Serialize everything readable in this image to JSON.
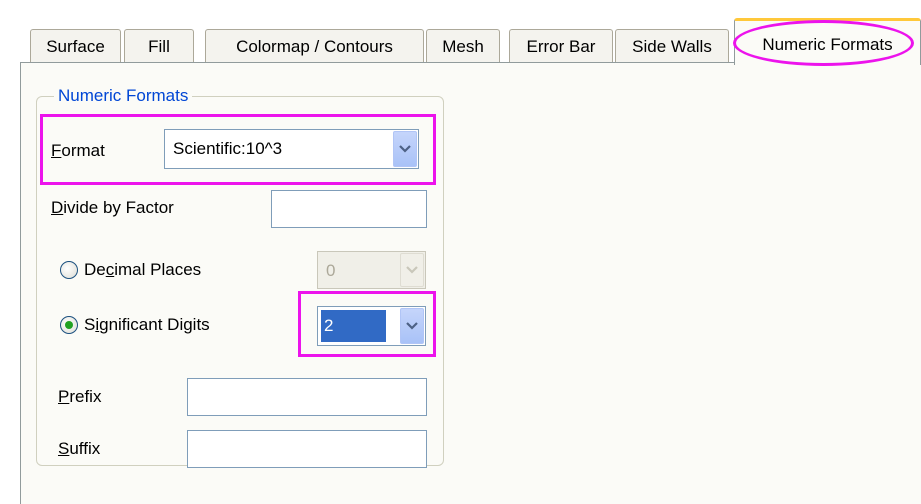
{
  "tabs": [
    {
      "label": "Surface",
      "accel": ""
    },
    {
      "label": "Fill",
      "accel": ""
    },
    {
      "label": "Colormap / Contours",
      "accel": ""
    },
    {
      "label": "Mesh",
      "accel": ""
    },
    {
      "label": "Error Bar",
      "accel": ""
    },
    {
      "label": "Side Walls",
      "accel": ""
    },
    {
      "label": "Numeric Formats",
      "accel": ""
    }
  ],
  "group_title": "Numeric Formats",
  "format": {
    "label_accel": "F",
    "label_rest": "ormat",
    "value": "Scientific:10^3"
  },
  "divide": {
    "label_accel": "D",
    "label_rest": "ivide by Factor",
    "value": ""
  },
  "decimal": {
    "label_pre": "De",
    "label_accel": "c",
    "label_rest": "imal Places",
    "value": "0",
    "selected": false,
    "enabled": false
  },
  "significant": {
    "label_pre": "S",
    "label_accel": "i",
    "label_rest": "gnificant Digits",
    "value": "2",
    "selected": true
  },
  "prefix": {
    "label_accel": "P",
    "label_rest": "refix",
    "value": ""
  },
  "suffix": {
    "label_accel": "S",
    "label_rest": "uffix",
    "value": ""
  },
  "colors": {
    "highlight": "#ec13ec",
    "active_tab_top": "#ffc83a",
    "group_title": "#0046d5",
    "selection": "#316ac5"
  }
}
